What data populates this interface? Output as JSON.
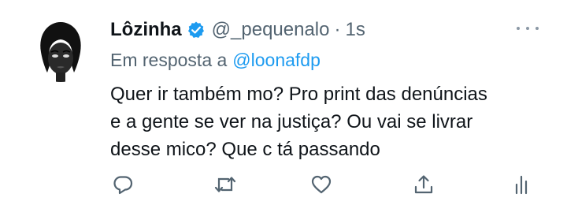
{
  "tweet": {
    "name": "Lôzinha",
    "handle": "@_pequenalo",
    "separator": "·",
    "time": "1s",
    "reply_prefix": "Em resposta a",
    "reply_to": "@loonafdp",
    "text_lines": [
      "Quer ir também mo? Pro print das denúncias",
      "e a gente se ver na justiça? Ou vai se livrar",
      "desse mico? Que c tá passando"
    ]
  },
  "icons": {
    "verified": "verified-badge-icon",
    "more": "more-dots-icon",
    "reply": "reply-icon",
    "retweet": "retweet-icon",
    "like": "heart-icon",
    "share": "share-icon",
    "analytics": "analytics-icon"
  },
  "colors": {
    "accent": "#1d9bf0",
    "text": "#0f1419",
    "muted": "#536471"
  }
}
